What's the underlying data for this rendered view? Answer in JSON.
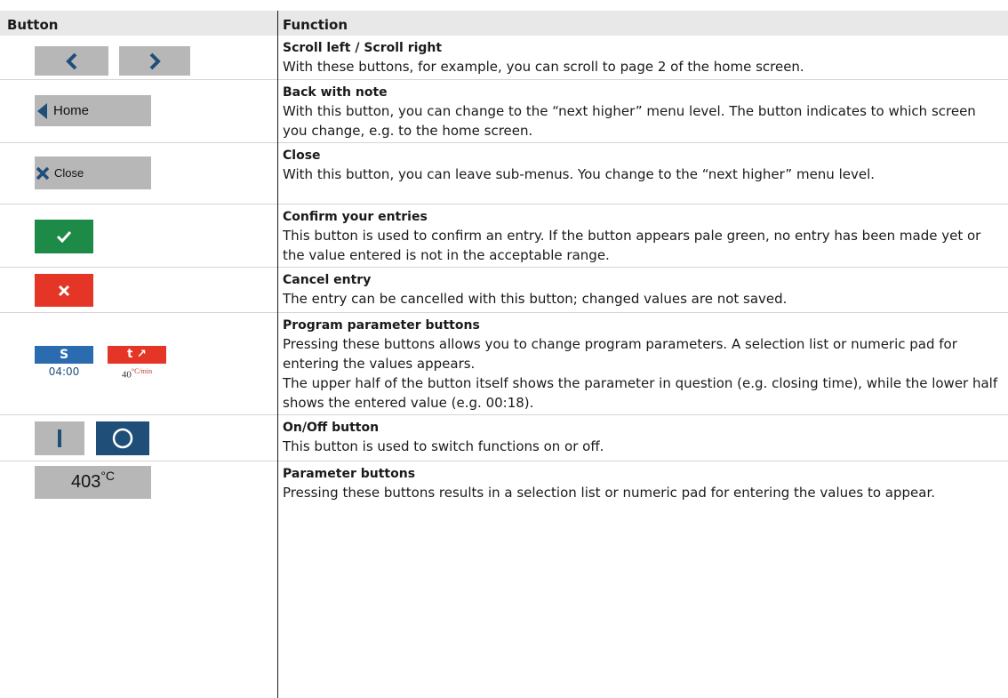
{
  "table": {
    "col_button": "Button",
    "col_function": "Function"
  },
  "rows": [
    {
      "title": "Scroll left / Scroll right",
      "desc": "With these buttons, for example, you can scroll to page 2 of the home screen."
    },
    {
      "title": "Back with note",
      "desc": "With this button, you can change to the “next higher” menu level. The button indicates to which screen you change, e.g. to the home screen.",
      "button_label": "Home"
    },
    {
      "title": "Close",
      "desc": "With this button, you can leave sub-menus. You change to the “next higher” menu level.",
      "button_label": "Close"
    },
    {
      "title": "Confirm your entries",
      "desc": "This button is used to confirm an entry. If the button appears pale green, no entry has been made yet or the value entered is not in the acceptable range."
    },
    {
      "title": "Cancel entry",
      "desc": "The entry can be cancelled with this button; changed values are not saved."
    },
    {
      "title": "Program parameter buttons",
      "desc": "Pressing these buttons allows you to change program parameters. A selection list or numeric pad for entering the values appears.",
      "desc2": "The upper half of the button itself shows the parameter in question (e.g. closing time), while the lower half shows the entered value (e.g. 00:18).",
      "param_s_label": "S",
      "param_s_value": "04:00",
      "param_t_label": "t ↗",
      "param_t_value": "40",
      "param_t_unit": "°C/min"
    },
    {
      "title": "On/Off button",
      "desc": "This button is used to switch functions on or off."
    },
    {
      "title": "Parameter buttons",
      "desc": "Pressing these buttons results in a selection list or numeric pad for entering the values to appear.",
      "button_value": "403",
      "button_unit": "°C"
    }
  ],
  "colors": {
    "button_grey": "#b7b7b7",
    "icon_navy": "#1f4e79",
    "confirm_green": "#1e8a47",
    "cancel_red": "#e53527",
    "param_blue": "#2b6cb0"
  },
  "icons": [
    "chevron-left-icon",
    "chevron-right-icon",
    "triangle-left-icon",
    "close-x-icon",
    "checkmark-icon",
    "cross-icon",
    "on-bar-icon",
    "off-circle-icon"
  ]
}
